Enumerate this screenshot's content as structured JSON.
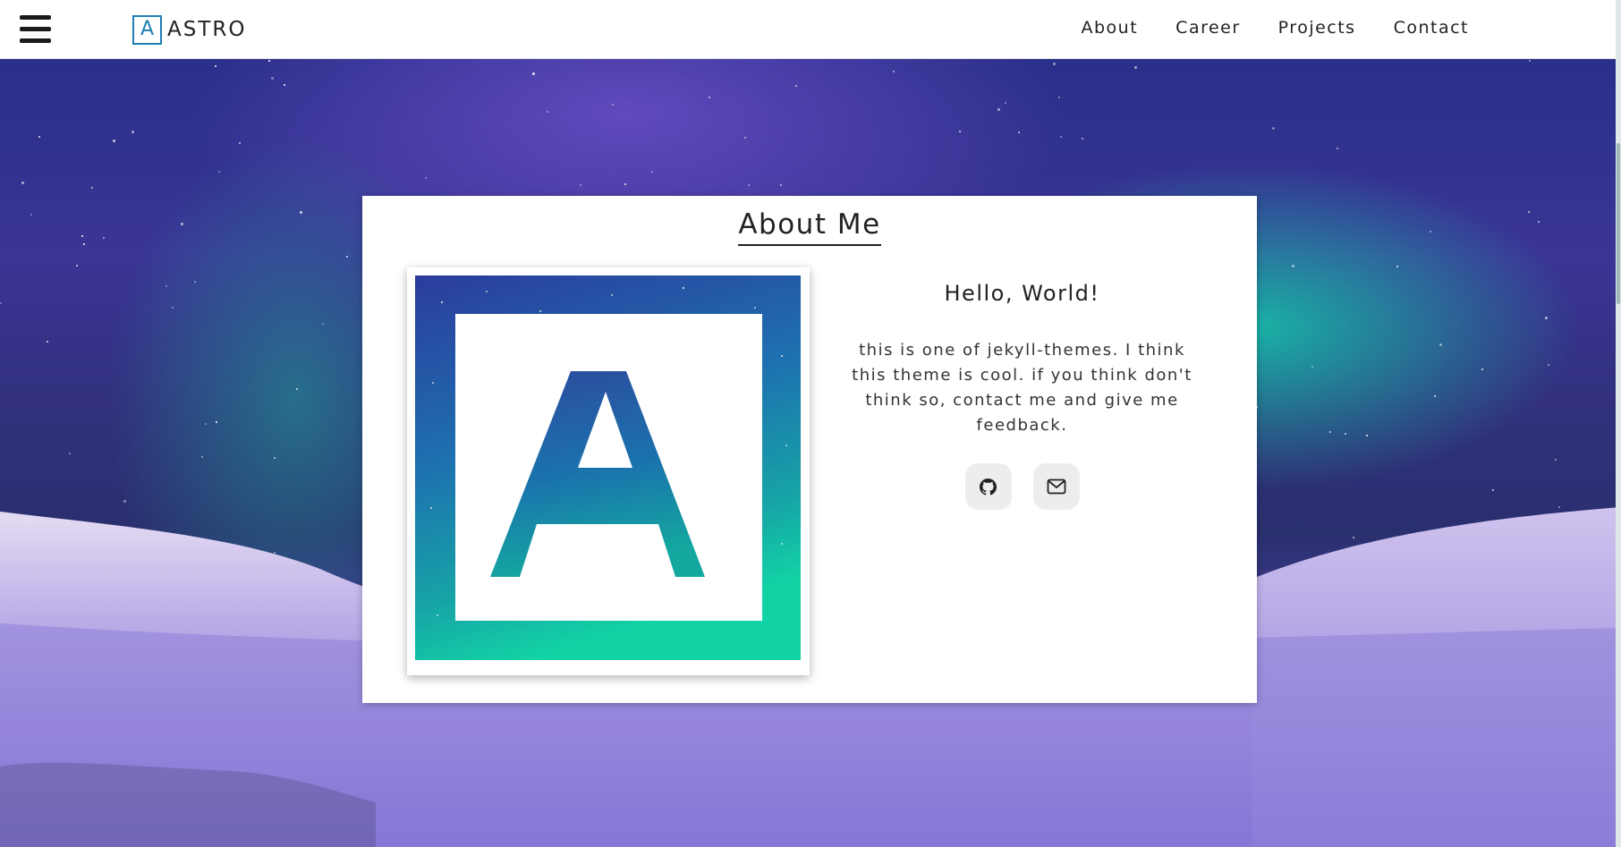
{
  "header": {
    "brand_mark": "A",
    "brand_text": "ASTRO",
    "nav": [
      {
        "label": "About"
      },
      {
        "label": "Career"
      },
      {
        "label": "Projects"
      },
      {
        "label": "Contact"
      }
    ]
  },
  "about": {
    "title": "About Me",
    "avatar_letter": "A",
    "greeting": "Hello, World!",
    "description": "this is one of jekyll-themes. I think this theme is cool. if you think don't think so, contact me and give me feedback.",
    "social": [
      {
        "icon": "github-icon"
      },
      {
        "icon": "envelope-icon"
      }
    ]
  },
  "colors": {
    "brand_blue": "#1f7fb3",
    "gradient_top": "#2c3a9a",
    "gradient_bottom": "#10c8a8"
  }
}
